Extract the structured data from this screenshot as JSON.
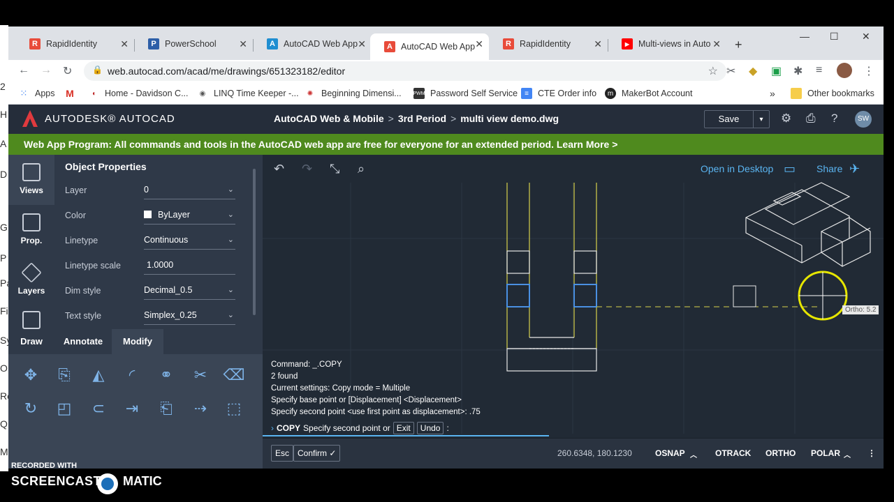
{
  "browser": {
    "tabs": [
      {
        "label": "RapidIdentity",
        "color": "#e84b3a",
        "glyph": "R"
      },
      {
        "label": "PowerSchool",
        "color": "#2d5fa8",
        "glyph": "P"
      },
      {
        "label": "AutoCAD Web App",
        "color": "#1f8ed1",
        "glyph": "A"
      },
      {
        "label": "AutoCAD Web App",
        "color": "#e84b3a",
        "glyph": "A"
      },
      {
        "label": "RapidIdentity",
        "color": "#e84b3a",
        "glyph": "R"
      },
      {
        "label": "Multi-views in Auto",
        "color": "#ff0000",
        "glyph": "▶"
      }
    ],
    "url": "web.autocad.com/acad/me/drawings/651323182/editor",
    "bookmarks": [
      {
        "label": "Apps",
        "icon": "apps-icon"
      },
      {
        "label": "",
        "icon": "gmail-icon"
      },
      {
        "label": "Home - Davidson C...",
        "icon": "davidson-icon"
      },
      {
        "label": "LINQ Time Keeper -...",
        "icon": "linq-icon"
      },
      {
        "label": "Beginning Dimensi...",
        "icon": "dimension-icon"
      },
      {
        "label": "Password Self Service",
        "icon": "pwm-icon"
      },
      {
        "label": "CTE Order info",
        "icon": "doc-icon"
      },
      {
        "label": "MakerBot Account",
        "icon": "makerbot-icon"
      }
    ],
    "other_bookmarks": "Other bookmarks",
    "overflow": "»"
  },
  "app": {
    "brand": "AUTODESK® AUTOCAD",
    "crumbs": [
      "AutoCAD Web & Mobile",
      "3rd Period",
      "multi view demo.dwg"
    ],
    "crumb_sep": ">",
    "save": "Save",
    "avatar": "SW",
    "banner": "Web App Program: All commands and tools in the AutoCAD web app are free for everyone for an extended period.  Learn More >",
    "nav": [
      "Views",
      "Prop.",
      "Layers"
    ],
    "props_title": "Object Properties",
    "props": [
      {
        "label": "Layer",
        "value": "0"
      },
      {
        "label": "Color",
        "value": "ByLayer"
      },
      {
        "label": "Linetype",
        "value": "Continuous"
      },
      {
        "label": "Linetype scale",
        "value": "1.0000"
      },
      {
        "label": "Dim style",
        "value": "Decimal_0.5"
      },
      {
        "label": "Text style",
        "value": "Simplex_0.25"
      }
    ],
    "tool_tabs": [
      "Draw",
      "Annotate",
      "Modify"
    ],
    "open_desktop": "Open in Desktop",
    "share": "Share",
    "command_lines": [
      "Command: _.COPY",
      "2 found",
      "Current settings: Copy mode = Multiple",
      "Specify base point or [Displacement] <Displacement>",
      "Specify second point <use first point as displacement>: .75"
    ],
    "cmd_prompt_name": "COPY",
    "cmd_prompt_text": "Specify second point or",
    "cmd_exit": "Exit",
    "cmd_undo": "Undo",
    "cmd_colon": ":",
    "esc": "Esc",
    "confirm": "Confirm ✓",
    "coords": "260.6348, 180.1230",
    "status_flags": [
      "OSNAP",
      "OTRACK",
      "ORTHO",
      "POLAR"
    ],
    "ortho_tooltip": "Ortho: 5.2"
  },
  "overlay": {
    "recorded": "RECORDED WITH",
    "screencast": "SCREENCAST",
    "matic": "MATIC"
  },
  "desktop_strip": [
    "2",
    "H",
    "A",
    "D",
    "G",
    "P",
    "Pa",
    "Fi",
    "Sy",
    "O",
    "Re",
    "Q",
    "M"
  ]
}
